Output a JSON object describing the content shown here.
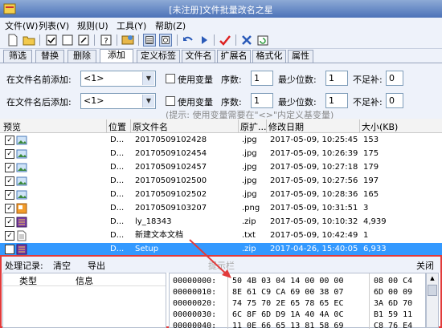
{
  "window": {
    "title": "[未注册]文件批量改名之星"
  },
  "menu": [
    "文件(W)",
    "列表(V)",
    "规则(U)",
    "工具(Y)",
    "帮助(Z)"
  ],
  "tabs": [
    "筛选",
    "替换",
    "删除",
    "添加",
    "定义标签",
    "文件名",
    "扩展名",
    "格式化",
    "属性"
  ],
  "active_tab": "添加",
  "panel": {
    "prefix_label": "在文件名前添加:",
    "prefix_value": "<1>",
    "suffix_label": "在文件名后添加:",
    "suffix_value": "<1>",
    "use_var_label": "使用变量",
    "seq_label": "序数:",
    "seq_value": "1",
    "min_digits_label": "最少位数:",
    "min_digits_value": "1",
    "pad_label": "不足补:",
    "pad_value": "0",
    "hint": "(提示: 使用变量需要在\"<>\"内定义基变量)"
  },
  "list": {
    "columns": [
      "预览",
      "位置",
      "原文件名",
      "原扩...",
      "修改日期",
      "大小(KB)"
    ],
    "rows": [
      {
        "pos": "D...",
        "name": "20170509102428",
        "ext": ".jpg",
        "date": "2017-05-09, 10:25:45",
        "size": "153",
        "icon": "image-file-icon",
        "selected": false
      },
      {
        "pos": "D...",
        "name": "20170509102454",
        "ext": ".jpg",
        "date": "2017-05-09, 10:26:39",
        "size": "175",
        "icon": "image-file-icon",
        "selected": false
      },
      {
        "pos": "D...",
        "name": "20170509102457",
        "ext": ".jpg",
        "date": "2017-05-09, 10:27:18",
        "size": "179",
        "icon": "image-file-icon",
        "selected": false
      },
      {
        "pos": "D...",
        "name": "20170509102500",
        "ext": ".jpg",
        "date": "2017-05-09, 10:27:56",
        "size": "197",
        "icon": "image-file-icon",
        "selected": false
      },
      {
        "pos": "D...",
        "name": "20170509102502",
        "ext": ".jpg",
        "date": "2017-05-09, 10:28:36",
        "size": "165",
        "icon": "image-file-icon",
        "selected": false
      },
      {
        "pos": "D...",
        "name": "20170509103207",
        "ext": ".png",
        "date": "2017-05-09, 10:31:51",
        "size": "3",
        "icon": "png-file-icon",
        "selected": false
      },
      {
        "pos": "D...",
        "name": "ly_18343",
        "ext": ".zip",
        "date": "2017-05-09, 10:10:32",
        "size": "4,939",
        "icon": "zip-file-icon",
        "selected": false
      },
      {
        "pos": "D...",
        "name": "新建文本文档",
        "ext": ".txt",
        "date": "2017-05-09, 10:42:49",
        "size": "1",
        "icon": "text-file-icon",
        "selected": false
      },
      {
        "pos": "D...",
        "name": "Setup",
        "ext": ".zip",
        "date": "2017-04-26, 15:40:05",
        "size": "6,933",
        "icon": "zip-file-icon",
        "selected": true
      }
    ]
  },
  "bottom": {
    "log_label": "处理记录:",
    "clear_label": "清空",
    "export_label": "导出",
    "hint_bar": "提示栏",
    "close_label": "关闭",
    "log_columns": [
      "类型",
      "信息"
    ],
    "hex": [
      {
        "addr": "00000000:",
        "bytes1": "50 4B 03 04 14 00 00 00",
        "bytes2": "08 00 C4"
      },
      {
        "addr": "00000010:",
        "bytes1": "8E 61 C9 CA 69 00 38 07",
        "bytes2": "6D 00 09"
      },
      {
        "addr": "00000020:",
        "bytes1": "74 75 70 2E 65 78 65 EC",
        "bytes2": "3A 6D 70"
      },
      {
        "addr": "00000030:",
        "bytes1": "6C 8F 6D D9 1A 40 4A 0C",
        "bytes2": "B1 59 11"
      },
      {
        "addr": "00000040:",
        "bytes1": "11 0E 66 65 13 81 58 69",
        "bytes2": "C8 76 E4"
      }
    ]
  },
  "colors": {
    "accent": "#3399ff",
    "annotation": "#e23b3b"
  }
}
